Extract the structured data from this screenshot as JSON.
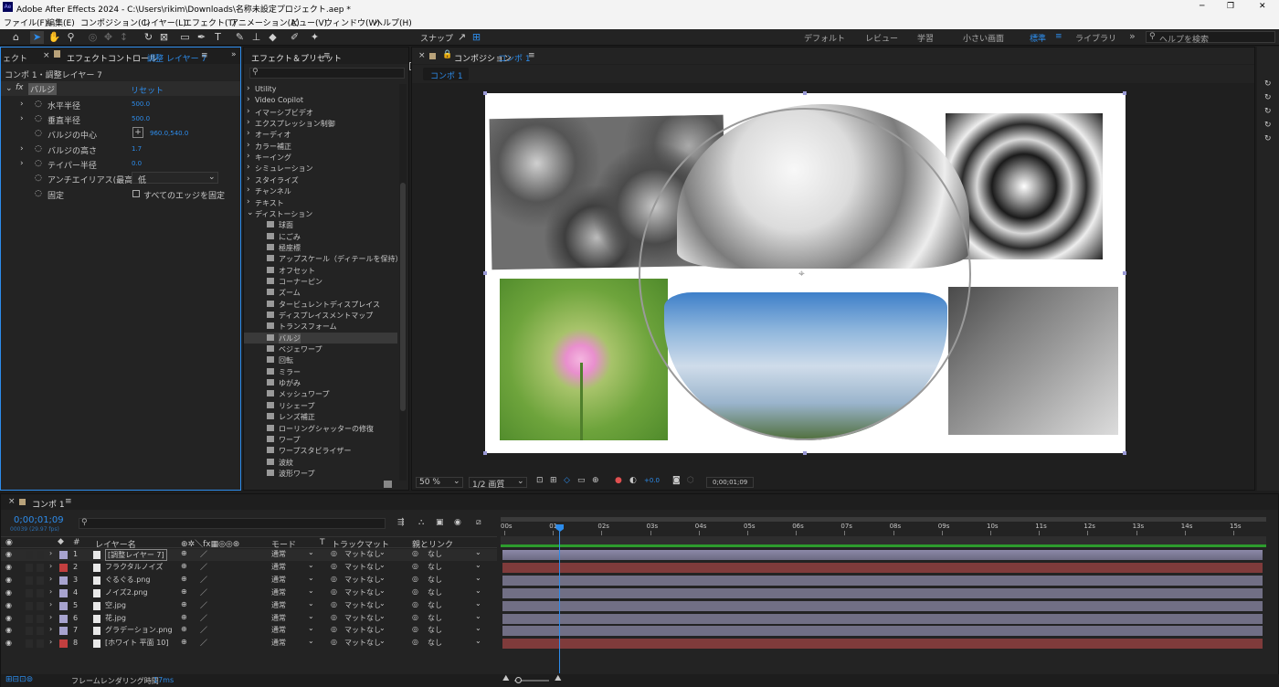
{
  "title": {
    "app_badge": "Ae",
    "text": "Adobe After Effects 2024 - C:\\Users\\rikim\\Downloads\\名称未設定プロジェクト.aep *",
    "min": "─",
    "max": "❐",
    "close": "✕"
  },
  "menu": [
    "ファイル(F)",
    "編集(E)",
    "コンポジション(C)",
    "レイヤー(L)",
    "エフェクト(T)",
    "アニメーション(A)",
    "ビュー(V)",
    "ウィンドウ(W)",
    "ヘルプ(H)"
  ],
  "toolbar": {
    "snap_label": "スナップ",
    "workspaces": [
      "デフォルト",
      "レビュー",
      "学習",
      "小さい画面",
      "標準",
      "ライブラリ"
    ],
    "more": "»",
    "help_placeholder": "ヘルプを検索"
  },
  "effect_controls": {
    "left_tab": "ェクト",
    "tab_title": "エフェクトコントロール",
    "layer_name": "調整 レイヤー 7",
    "comp_layer": "コンポ 1・調整レイヤー 7",
    "fx": "fx",
    "effect_name": "バルジ",
    "reset": "リセット",
    "props": [
      {
        "name": "水平半径",
        "value": "500.0"
      },
      {
        "name": "垂直半径",
        "value": "500.0"
      },
      {
        "name": "バルジの中心",
        "value": "960.0,540.0"
      },
      {
        "name": "バルジの高さ",
        "value": "1.7"
      },
      {
        "name": "テイパー半径",
        "value": "0.0"
      }
    ],
    "antialias_label": "アンチエイリアス(最高",
    "antialias_value": "低",
    "pin_label": "固定",
    "pin_checkbox": "すべてのエッジを固定"
  },
  "effects_presets": {
    "tab": "エフェクト＆プリセット",
    "search_placeholder": "",
    "categories": [
      "Utility",
      "Video Copilot",
      "イマーシブビデオ",
      "エクスプレッション制御",
      "オーディオ",
      "カラー補正",
      "キーイング",
      "シミュレーション",
      "スタイライズ",
      "チャンネル",
      "テキスト"
    ],
    "open_category": "ディストーション",
    "items": [
      "球面",
      "にごみ",
      "極座標",
      "アップスケール（ディテールを保持）",
      "オフセット",
      "コーナーピン",
      "ズーム",
      "タービュレントディスプレイス",
      "ディスプレイスメントマップ",
      "トランスフォーム",
      "バルジ",
      "ベジェワープ",
      "回転",
      "ミラー",
      "ゆがみ",
      "メッシュワープ",
      "リシェープ",
      "レンズ補正",
      "ローリングシャッターの修復",
      "ワープ",
      "ワープスタビライザー",
      "波紋",
      "波形ワープ"
    ],
    "selected": "バルジ"
  },
  "composition": {
    "tab": "コンポジション",
    "comp_name": "コンポ 1",
    "sub_tab": "コンポ 1",
    "zoom": "50 %",
    "resolution": "1/2 画質",
    "exposure": "+0.0",
    "timecode": "0;00;01;09"
  },
  "timeline": {
    "tab": "コンポ 1",
    "timecode": "0;00;01;09",
    "frame_info": "00039 (29.97 fps)",
    "search_placeholder": "",
    "headers": {
      "name": "レイヤー名",
      "mode": "モード",
      "t": "T",
      "track_matte": "トラックマット",
      "parent": "親とリンク"
    },
    "ruler": [
      "00s",
      "01s",
      "02s",
      "03s",
      "04s",
      "05s",
      "06s",
      "07s",
      "08s",
      "09s",
      "10s",
      "11s",
      "12s",
      "13s",
      "14s",
      "15s"
    ],
    "current_time_fraction": 0.0757,
    "layers": [
      {
        "num": "1",
        "name": "[調整レイヤー 7]",
        "color": "#a7a3cf",
        "mode": "通常",
        "matte": "マットなし",
        "parent": "なし",
        "bar": "#716f85",
        "selected": true
      },
      {
        "num": "2",
        "name": "フラクタルノイズ",
        "color": "#c23f3f",
        "mode": "通常",
        "matte": "マットなし",
        "parent": "なし",
        "bar": "#7f3b3b"
      },
      {
        "num": "3",
        "name": "ぐるぐる.png",
        "color": "#a7a3cf",
        "mode": "通常",
        "matte": "マットなし",
        "parent": "なし",
        "bar": "#716f85"
      },
      {
        "num": "4",
        "name": "ノイズ2.png",
        "color": "#a7a3cf",
        "mode": "通常",
        "matte": "マットなし",
        "parent": "なし",
        "bar": "#716f85"
      },
      {
        "num": "5",
        "name": "空.jpg",
        "color": "#a7a3cf",
        "mode": "通常",
        "matte": "マットなし",
        "parent": "なし",
        "bar": "#716f85"
      },
      {
        "num": "6",
        "name": "花.jpg",
        "color": "#a7a3cf",
        "mode": "通常",
        "matte": "マットなし",
        "parent": "なし",
        "bar": "#716f85"
      },
      {
        "num": "7",
        "name": "グラデーション.png",
        "color": "#a7a3cf",
        "mode": "通常",
        "matte": "マットなし",
        "parent": "なし",
        "bar": "#716f85"
      },
      {
        "num": "8",
        "name": "[ホワイト 平面 10]",
        "color": "#c23f3f",
        "mode": "通常",
        "matte": "マットなし",
        "parent": "なし",
        "bar": "#7f3b3b"
      }
    ],
    "footer": {
      "render_label": "フレームレンダリング時間",
      "render_value": "17ms"
    }
  },
  "colors": {
    "accent": "#2d8ceb",
    "panel": "#232323",
    "bg": "#1d1d1d",
    "timeline_cti": "#2d8ceb"
  }
}
